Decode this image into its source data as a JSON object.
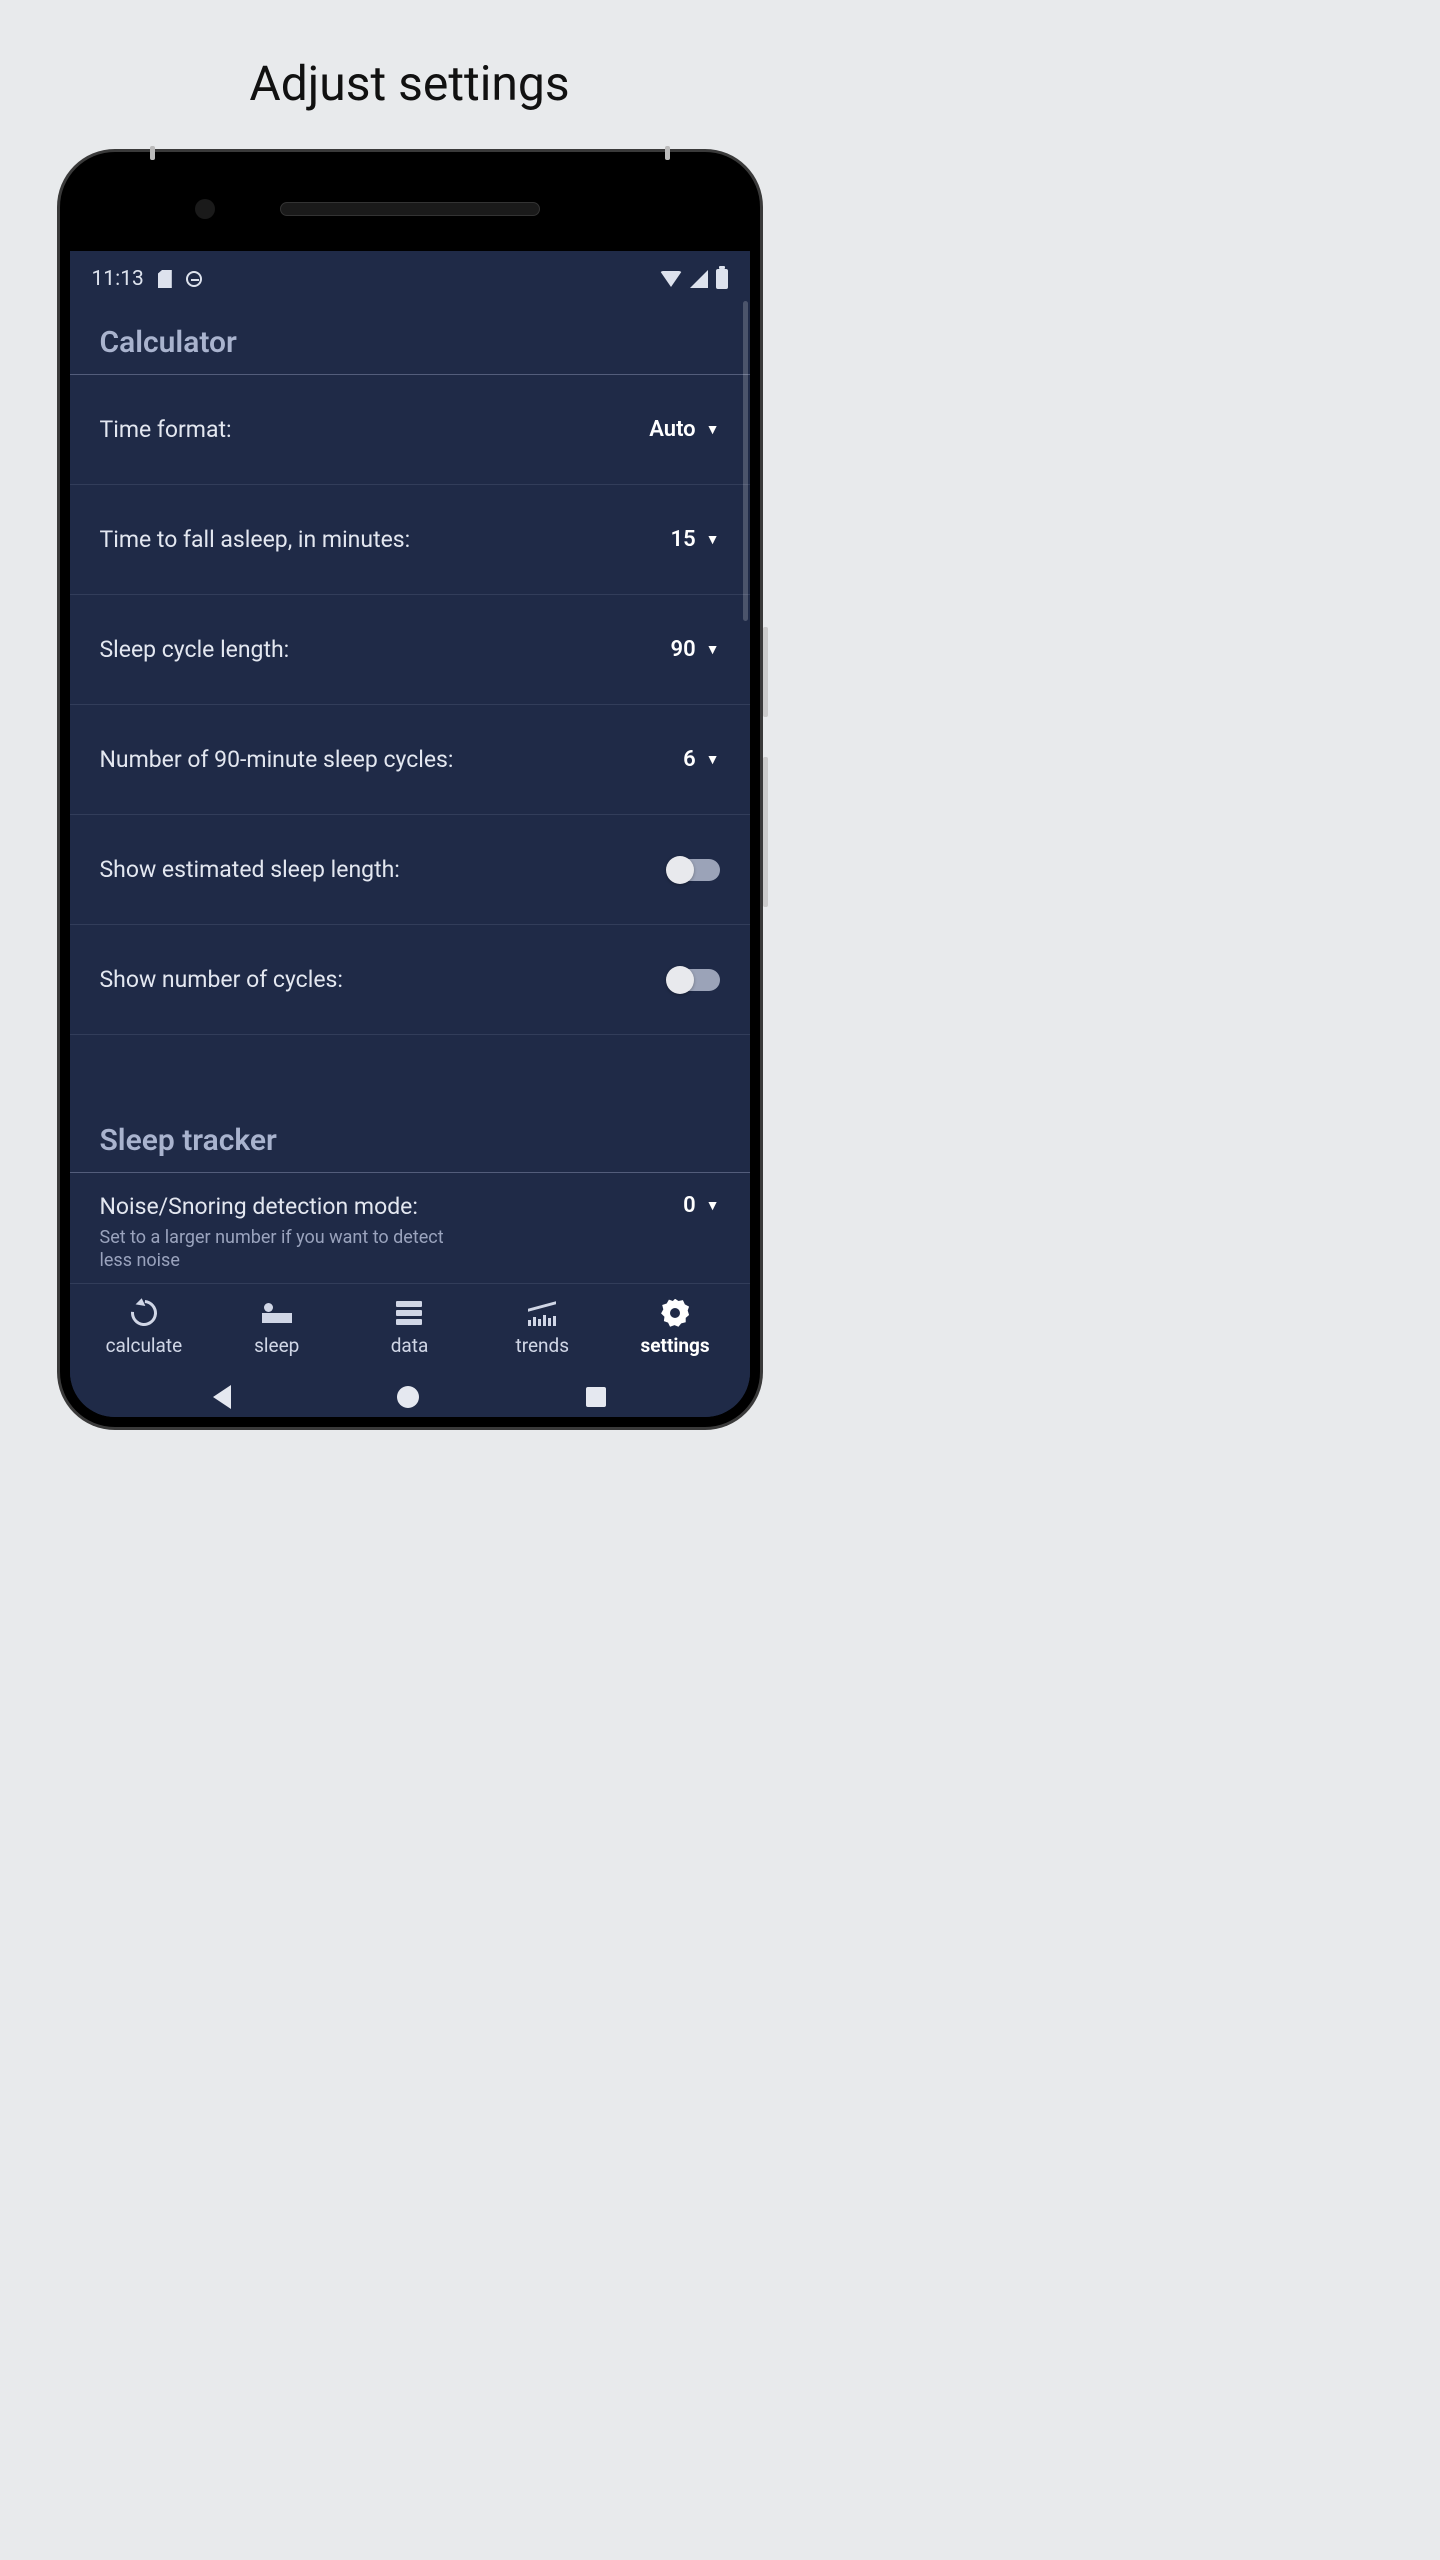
{
  "page": {
    "title": "Adjust settings"
  },
  "status_bar": {
    "time": "11:13"
  },
  "sections": {
    "calculator": {
      "header": "Calculator",
      "rows": {
        "time_format": {
          "label": "Time format:",
          "value": "Auto"
        },
        "fall_asleep": {
          "label": "Time to fall asleep, in minutes:",
          "value": "15"
        },
        "cycle_length": {
          "label": "Sleep cycle length:",
          "value": "90"
        },
        "num_cycles": {
          "label": "Number of 90-minute sleep cycles:",
          "value": "6"
        },
        "show_length": {
          "label": "Show estimated sleep length:",
          "enabled": false
        },
        "show_cycles": {
          "label": "Show number of cycles:",
          "enabled": false
        }
      }
    },
    "sleep_tracker": {
      "header": "Sleep tracker",
      "rows": {
        "noise_mode": {
          "label": "Noise/Snoring detection mode:",
          "sublabel": "Set to a larger number if you want to detect less noise",
          "value": "0"
        }
      }
    }
  },
  "nav": {
    "calculate": "calculate",
    "sleep": "sleep",
    "data": "data",
    "trends": "trends",
    "settings": "settings"
  }
}
